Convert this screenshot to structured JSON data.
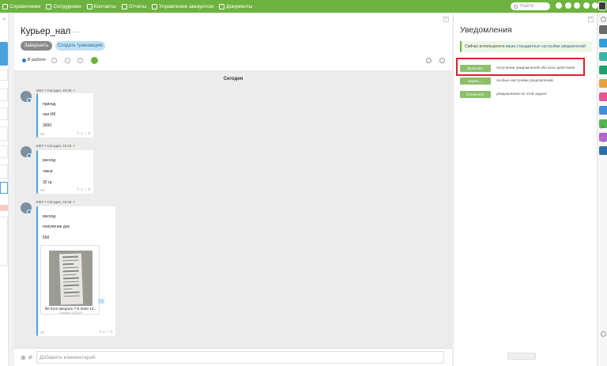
{
  "topbar": {
    "nav": [
      {
        "label": "Справочники",
        "icon": "book-icon"
      },
      {
        "label": "Сотрудники",
        "icon": "users-icon"
      },
      {
        "label": "Контакты",
        "icon": "contacts-icon"
      },
      {
        "label": "Отчеты",
        "icon": "chart-icon"
      },
      {
        "label": "Управление аккаунтом",
        "icon": "account-icon"
      },
      {
        "label": "Документы",
        "icon": "documents-icon"
      }
    ],
    "search_placeholder": "Найти",
    "accent": "#6db33f"
  },
  "task": {
    "title": "Курьер_нал",
    "finish_label": "Завершить",
    "create_label": "Создать транзакцию",
    "status_label": "В работе",
    "date_separator": "Сегодня",
    "comment_placeholder": "Добавить комментарий"
  },
  "messages": [
    {
      "meta": "MST • Сегодня, 15:09",
      "lines": [
        "приход",
        "нал ИК",
        "3000"
      ],
      "foot": "3л",
      "acts": "✎ 1 ♡ ↻"
    },
    {
      "meta": "MST • Сегодня, 16:34",
      "lines": [
        "расход",
        "такси",
        "32 гр"
      ],
      "foot": "3л",
      "acts": "✎ 1 ♡ ↻"
    },
    {
      "meta": "MST • Сегодня, 16:34",
      "lines": [
        "расход",
        "получение док",
        "550"
      ],
      "foot": "3л",
      "acts": "✎ 1 ♡ ↻",
      "attachment": {
        "name": "file from telegram 7-5-2020 13...",
        "size": "Скачать 1105 кб"
      }
    }
  ],
  "panel": {
    "title": "Уведомления",
    "notice_prefix": "Сейчас используются",
    "notice_link": "ваши стандартные настройки уведомлений",
    "rows": [
      {
        "button": "Включить",
        "text": "получение уведомлений обо всех действиях"
      },
      {
        "button": "Задать ...",
        "text": "особые настройки уведомлений"
      },
      {
        "button": "Отключить",
        "text": "уведомления по этой задаче"
      }
    ]
  },
  "right_strip_colors": [
    "#6a6a6a",
    "#2f9fd8",
    "#3ab5a8",
    "#1aa36a",
    "#e7a33e",
    "#e8549a",
    "#3d8edb",
    "#4fb84f",
    "#b45ed6",
    "#2c6fa8"
  ]
}
